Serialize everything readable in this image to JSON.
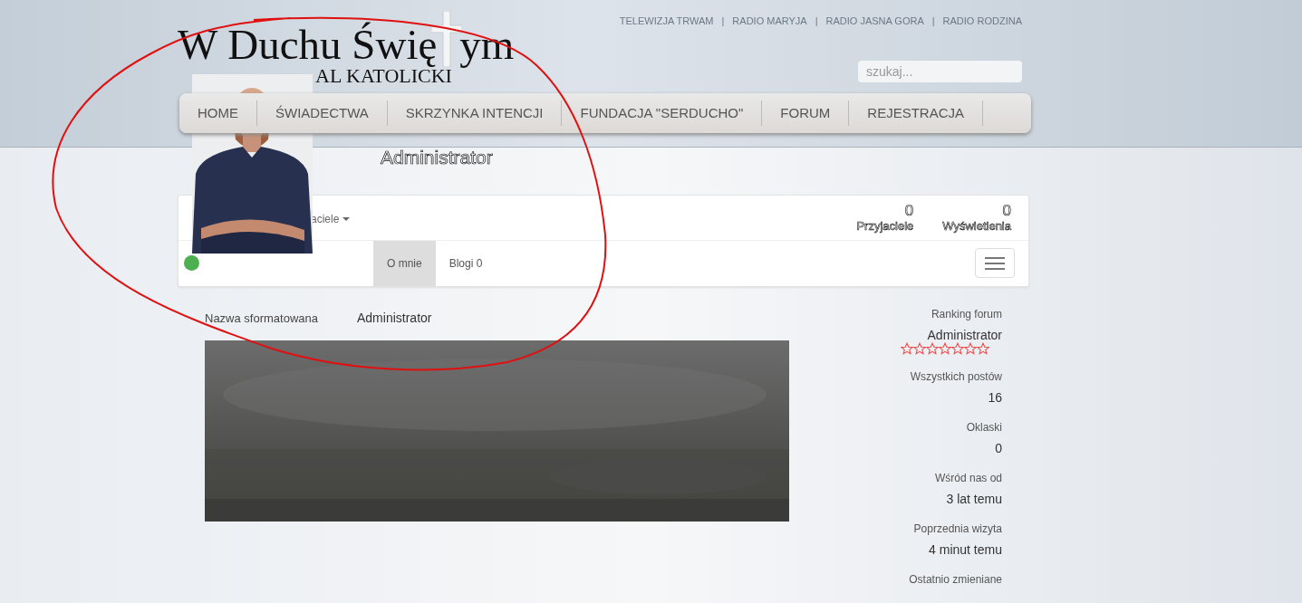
{
  "header": {
    "link_separator": "|",
    "top_links": [
      "TELEWIZJA TRWAM",
      "RADIO MARYJA",
      "RADIO JASNA GORA",
      "RADIO RODZINA"
    ],
    "logo": {
      "title_start": "W Duchu Świę",
      "title_end": "ym",
      "subtitle": "AL KATOLICKI"
    },
    "search": {
      "placeholder": "szukaj..."
    },
    "nav": [
      {
        "label": "HOME"
      },
      {
        "label": "ŚWIADECTWA"
      },
      {
        "label": "SKRZYNKA INTENCJI"
      },
      {
        "label": "FUNDACJA \"SERDUCHO\""
      },
      {
        "label": "FORUM"
      },
      {
        "label": "REJESTRACJA"
      }
    ]
  },
  "profile": {
    "title": "Administrator",
    "online": true,
    "friends_menu": "aciele",
    "stats": [
      {
        "value": "0",
        "label": "Przyjaciele"
      },
      {
        "value": "0",
        "label": "Wyświetlenia"
      }
    ],
    "tabs": [
      {
        "label": "O mnie",
        "selected": true
      },
      {
        "label": "Blogi 0",
        "selected": false
      }
    ]
  },
  "details": [
    {
      "label": "Nazwa sformatowana",
      "value": "Administrator"
    }
  ],
  "sidebar": {
    "rank_label": "Ranking forum",
    "rank": "Administrator",
    "stars": 0,
    "stats": [
      {
        "label": "Wszystkich postów",
        "value": "16"
      },
      {
        "label": "Oklaski",
        "value": "0"
      },
      {
        "label": "Wśród nas od",
        "value": "3 lat temu"
      },
      {
        "label": "Poprzednia wizyta",
        "value": "4 minut temu"
      },
      {
        "label": "Ostatnio zmieniane"
      }
    ]
  }
}
